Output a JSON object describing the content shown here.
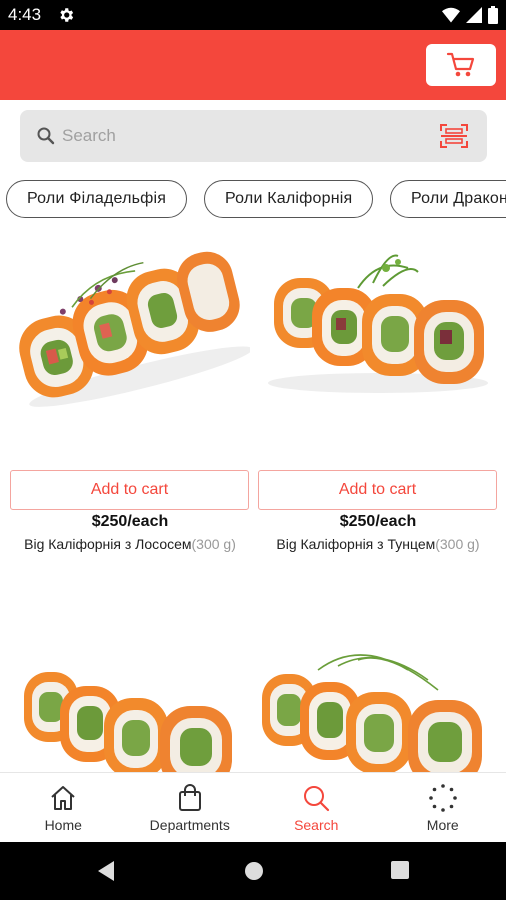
{
  "status_bar": {
    "time": "4:43"
  },
  "search": {
    "placeholder": "Search"
  },
  "categories": [
    {
      "label": "Роли Філадельфія"
    },
    {
      "label": "Роли Каліфорнія"
    },
    {
      "label": "Роли Дракон"
    }
  ],
  "products": [
    {
      "add_label": "Add to cart",
      "price": "$250/each",
      "name": "Big Каліфорнія з Лососем",
      "weight": "(300 g)"
    },
    {
      "add_label": "Add to cart",
      "price": "$250/each",
      "name": "Big Каліфорнія з Тунцем",
      "weight": "(300 g)"
    }
  ],
  "bottom_nav": [
    {
      "label": "Home",
      "icon": "home-icon"
    },
    {
      "label": "Departments",
      "icon": "shopping-bag-icon"
    },
    {
      "label": "Search",
      "icon": "search-icon",
      "active": true
    },
    {
      "label": "More",
      "icon": "more-dots-icon"
    }
  ],
  "colors": {
    "accent": "#f4473c",
    "search_bg": "#e6e6e6"
  }
}
